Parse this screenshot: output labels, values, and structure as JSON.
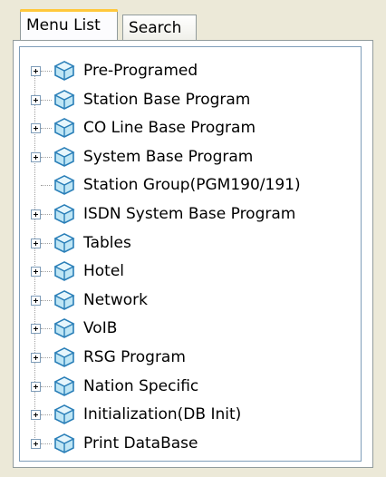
{
  "tabs": {
    "menu_list": "Menu List",
    "search": "Search"
  },
  "tree": {
    "items": [
      {
        "label": "Pre-Programed",
        "expandable": true
      },
      {
        "label": "Station Base Program",
        "expandable": true
      },
      {
        "label": "CO Line Base Program",
        "expandable": true
      },
      {
        "label": "System Base Program",
        "expandable": true
      },
      {
        "label": "Station Group(PGM190/191)",
        "expandable": false
      },
      {
        "label": "ISDN System Base Program",
        "expandable": true
      },
      {
        "label": "Tables",
        "expandable": true
      },
      {
        "label": "Hotel",
        "expandable": true
      },
      {
        "label": "Network",
        "expandable": true
      },
      {
        "label": "VoIB",
        "expandable": true
      },
      {
        "label": "RSG Program",
        "expandable": true
      },
      {
        "label": "Nation Specific",
        "expandable": true
      },
      {
        "label": "Initialization(DB Init)",
        "expandable": true
      },
      {
        "label": "Print DataBase",
        "expandable": true
      }
    ],
    "node_icon": "cube-icon",
    "expander_icon": "plus-box-icon"
  },
  "colors": {
    "window_bg": "#ece9d8",
    "panel_border": "#919b9c",
    "active_tab_accent": "#ffc83c",
    "cube_fill": "#bfe6f5",
    "cube_stroke": "#2a7fb8"
  }
}
